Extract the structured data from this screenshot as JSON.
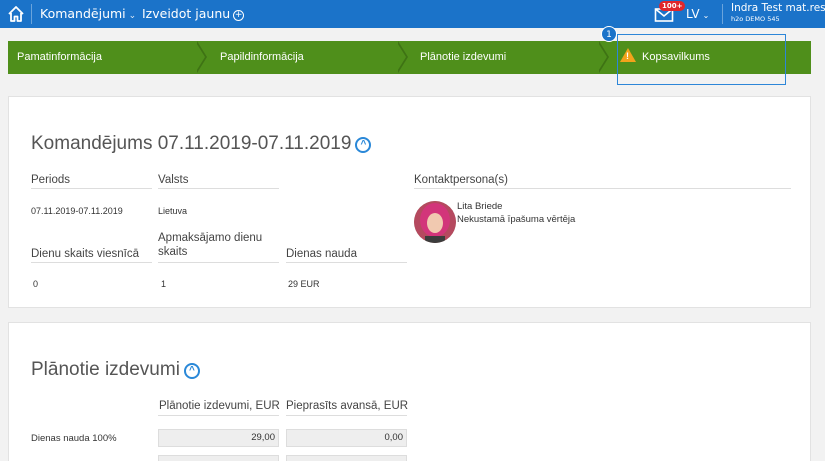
{
  "topbar": {
    "menu_trips": "Komandējumi",
    "menu_create": "Izveidot jaunu",
    "mail_badge": "100+",
    "lang": "LV",
    "user_name": "Indra Test mat.res",
    "user_org": "h2o DEMO 545"
  },
  "steps": {
    "items": [
      "Pamatinformācija",
      "Papildinformācija",
      "Plānotie izdevumi",
      "Kopsavilkums"
    ],
    "active_marker": "1",
    "warning_glyph": "!"
  },
  "trip": {
    "title": "Komandējums 07.11.2019-07.11.2019",
    "labels": {
      "period": "Periods",
      "country": "Valsts",
      "contact": "Kontaktpersona(s)",
      "hotel_days": "Dienu skaits viesnīcā",
      "paid_days": "Apmaksājamo dienu skaits",
      "daily_allowance": "Dienas nauda"
    },
    "values": {
      "period": "07.11.2019-07.11.2019",
      "country": "Lietuva",
      "hotel_days": "0",
      "paid_days": "1",
      "daily_allowance": "29 EUR"
    },
    "contact": {
      "name": "Lita Briede",
      "role": "Nekustamā īpašuma vērtēja"
    }
  },
  "planned": {
    "title": "Plānotie izdevumi",
    "col_planned": "Plānotie izdevumi, EUR",
    "col_advance": "Pieprasīts avansā, EUR",
    "rows": [
      {
        "label": "Dienas nauda 100%",
        "planned": "29,00",
        "advance": "0,00"
      }
    ]
  },
  "colors": {
    "topbar": "#1b73c9",
    "steps": "#4f8f1b",
    "accent": "#2a88d8",
    "warning": "#f2a31b"
  }
}
